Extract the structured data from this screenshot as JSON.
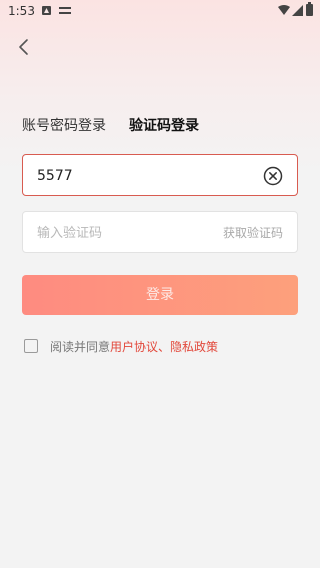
{
  "status_bar": {
    "time": "1:53"
  },
  "tabs": {
    "password_login": "账号密码登录",
    "code_login": "验证码登录"
  },
  "phone_field": {
    "value": "5577"
  },
  "code_field": {
    "placeholder": "输入验证码",
    "get_code_label": "获取验证码"
  },
  "login_button": {
    "label": "登录"
  },
  "agreement": {
    "prefix": "阅读并同意",
    "link": "用户协议、隐私政策"
  },
  "colors": {
    "accent": "#e2483b",
    "button_gradient_start": "#fe8b80",
    "button_gradient_end": "#fda07c",
    "active_field_border": "#d85b50"
  }
}
